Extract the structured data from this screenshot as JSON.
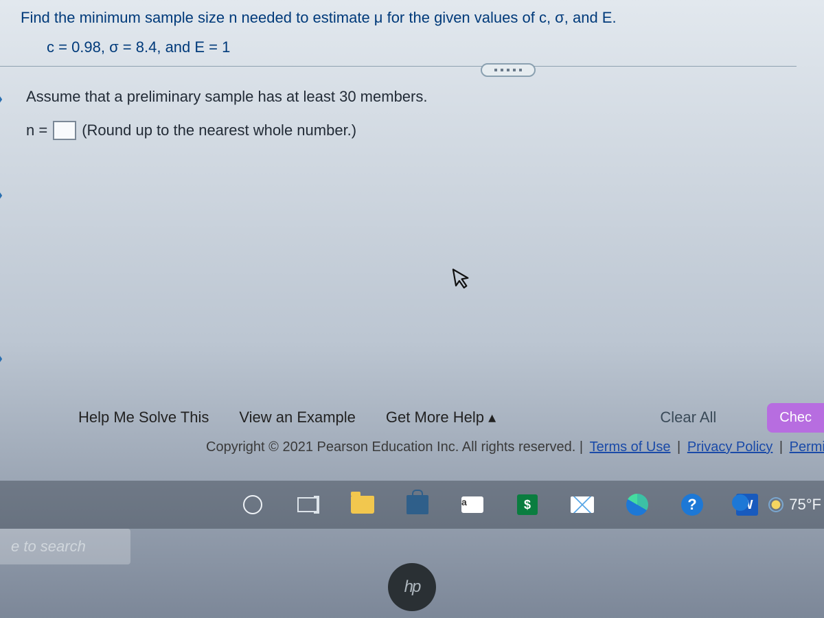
{
  "question": {
    "prompt": "Find the minimum sample size n needed to estimate μ for the given values of c, σ, and E.",
    "values_line": "c = 0.98, σ = 8.4, and E = 1",
    "assume": "Assume that a preliminary sample has at least 30 members.",
    "answer_prefix": "n =",
    "answer_value": "",
    "round_note": "(Round up to the nearest whole number.)"
  },
  "help_row": {
    "solve": "Help Me Solve This",
    "example": "View an Example",
    "more": "Get More Help",
    "more_caret": "▴",
    "clear": "Clear All",
    "check": "Chec"
  },
  "copyright": {
    "text": "Copyright © 2021 Pearson Education Inc. All rights reserved. | ",
    "terms": "Terms of Use",
    "sep": " | ",
    "privacy": "Privacy Policy",
    "permissions": "Permissio"
  },
  "taskbar": {
    "search_placeholder": "e to search",
    "temperature": "75°F",
    "word_label": "W",
    "amazon_label": "a",
    "help_label": "?"
  },
  "logo": "hp"
}
